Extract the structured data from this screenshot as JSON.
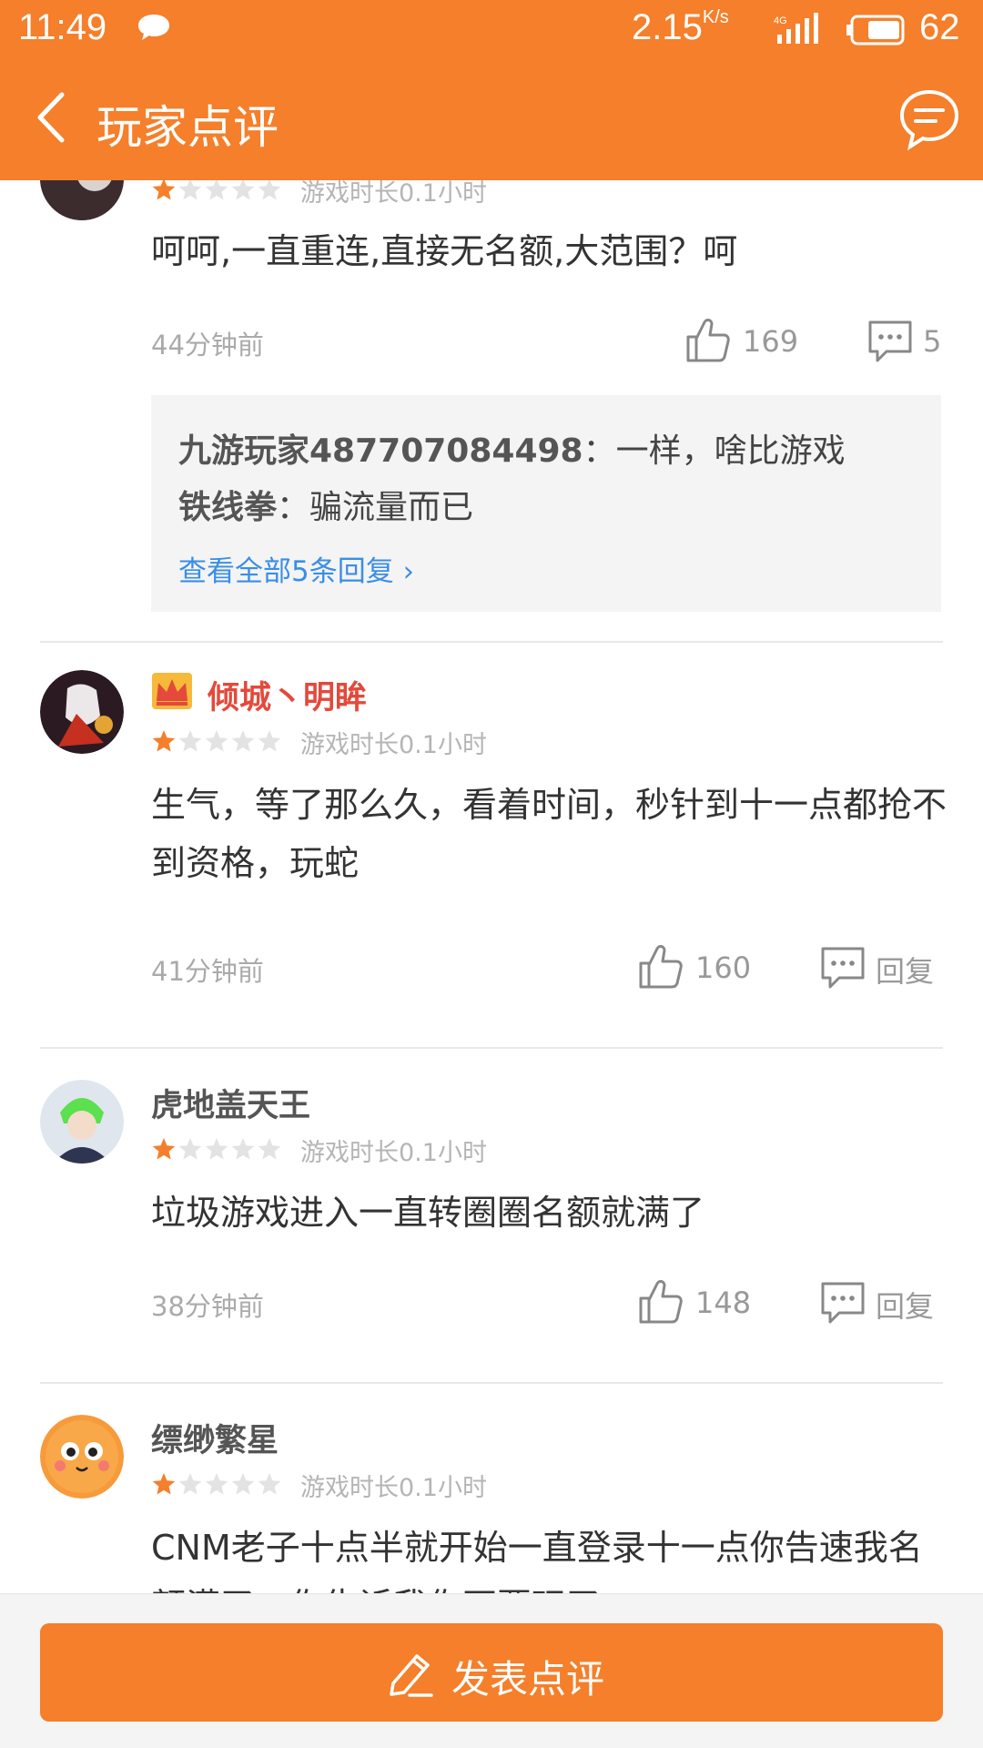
{
  "status_bar": {
    "time": "11:49",
    "speed": "2.15",
    "speed_unit": "K/s",
    "network": "4G",
    "battery": "62"
  },
  "app_bar": {
    "title": "玩家点评"
  },
  "reviews": [
    {
      "user": "",
      "rating": 1,
      "playtime": "游戏时长0.1小时",
      "content": "呵呵,一直重连,直接无名额,大范围？呵",
      "time_ago": "44分钟前",
      "likes": "169",
      "comments": "5",
      "replies": [
        {
          "user": "九游玩家487707084498",
          "sep": "：",
          "text": "一样，啥比游戏"
        },
        {
          "user": "铁线拳",
          "sep": "：",
          "text": "骗流量而已"
        }
      ],
      "more_replies": "查看全部5条回复",
      "more_arrow": "›"
    },
    {
      "user": "倾城丶明眸",
      "rating": 1,
      "playtime": "游戏时长0.1小时",
      "content": "生气，等了那么久，看着时间，秒针到十一点都抢不到资格，玩蛇",
      "time_ago": "41分钟前",
      "likes": "160",
      "reply_label": "回复"
    },
    {
      "user": "虎地盖天王",
      "rating": 1,
      "playtime": "游戏时长0.1小时",
      "content": "垃圾游戏进入一直转圈圈名额就满了",
      "time_ago": "38分钟前",
      "likes": "148",
      "reply_label": "回复"
    },
    {
      "user": "缥缈繁星",
      "rating": 1,
      "playtime": "游戏时长0.1小时",
      "content": "CNM老子十点半就开始一直登录十一点你告速我名额满了，你告诉我你不要玩了"
    }
  ],
  "bottom_button": {
    "label": "发表点评"
  },
  "colors": {
    "accent": "#f57f2a",
    "link": "#3a8ee6",
    "vip_name": "#e4493b",
    "star": "#f57f2a"
  }
}
